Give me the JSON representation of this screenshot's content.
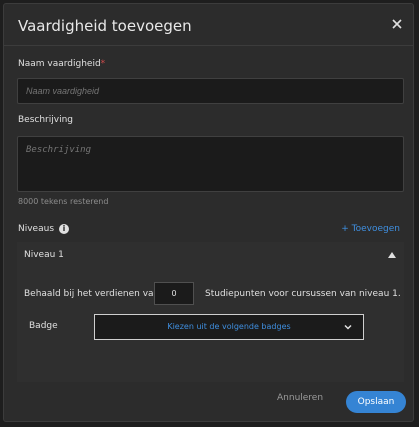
{
  "dialog": {
    "title": "Vaardigheid toevoegen",
    "close_icon": "close-icon"
  },
  "form": {
    "name_label": "Naam vaardigheid",
    "required_marker": "*",
    "name_placeholder": "Naam vaardigheid",
    "name_value": "",
    "description_label": "Beschrijving",
    "description_placeholder": "Beschrijving",
    "description_value": "",
    "chars_remaining": "8000 tekens resterend"
  },
  "levels": {
    "label": "Niveaus",
    "info_icon": "info-icon",
    "add_label": "+ Toevoegen",
    "items": [
      {
        "title": "Niveau 1",
        "earned_prefix": "Behaald bij het verdienen van",
        "points_value": "0",
        "earned_suffix": "Studiepunten voor cursussen van niveau 1.",
        "badge_label": "Badge",
        "badge_select": "Kiezen uit de volgende badges"
      }
    ]
  },
  "footer": {
    "cancel_label": "Annuleren",
    "save_label": "Opslaan"
  },
  "colors": {
    "accent": "#3f8fe0",
    "save_button": "#3584d4",
    "required": "#d14b4b"
  }
}
